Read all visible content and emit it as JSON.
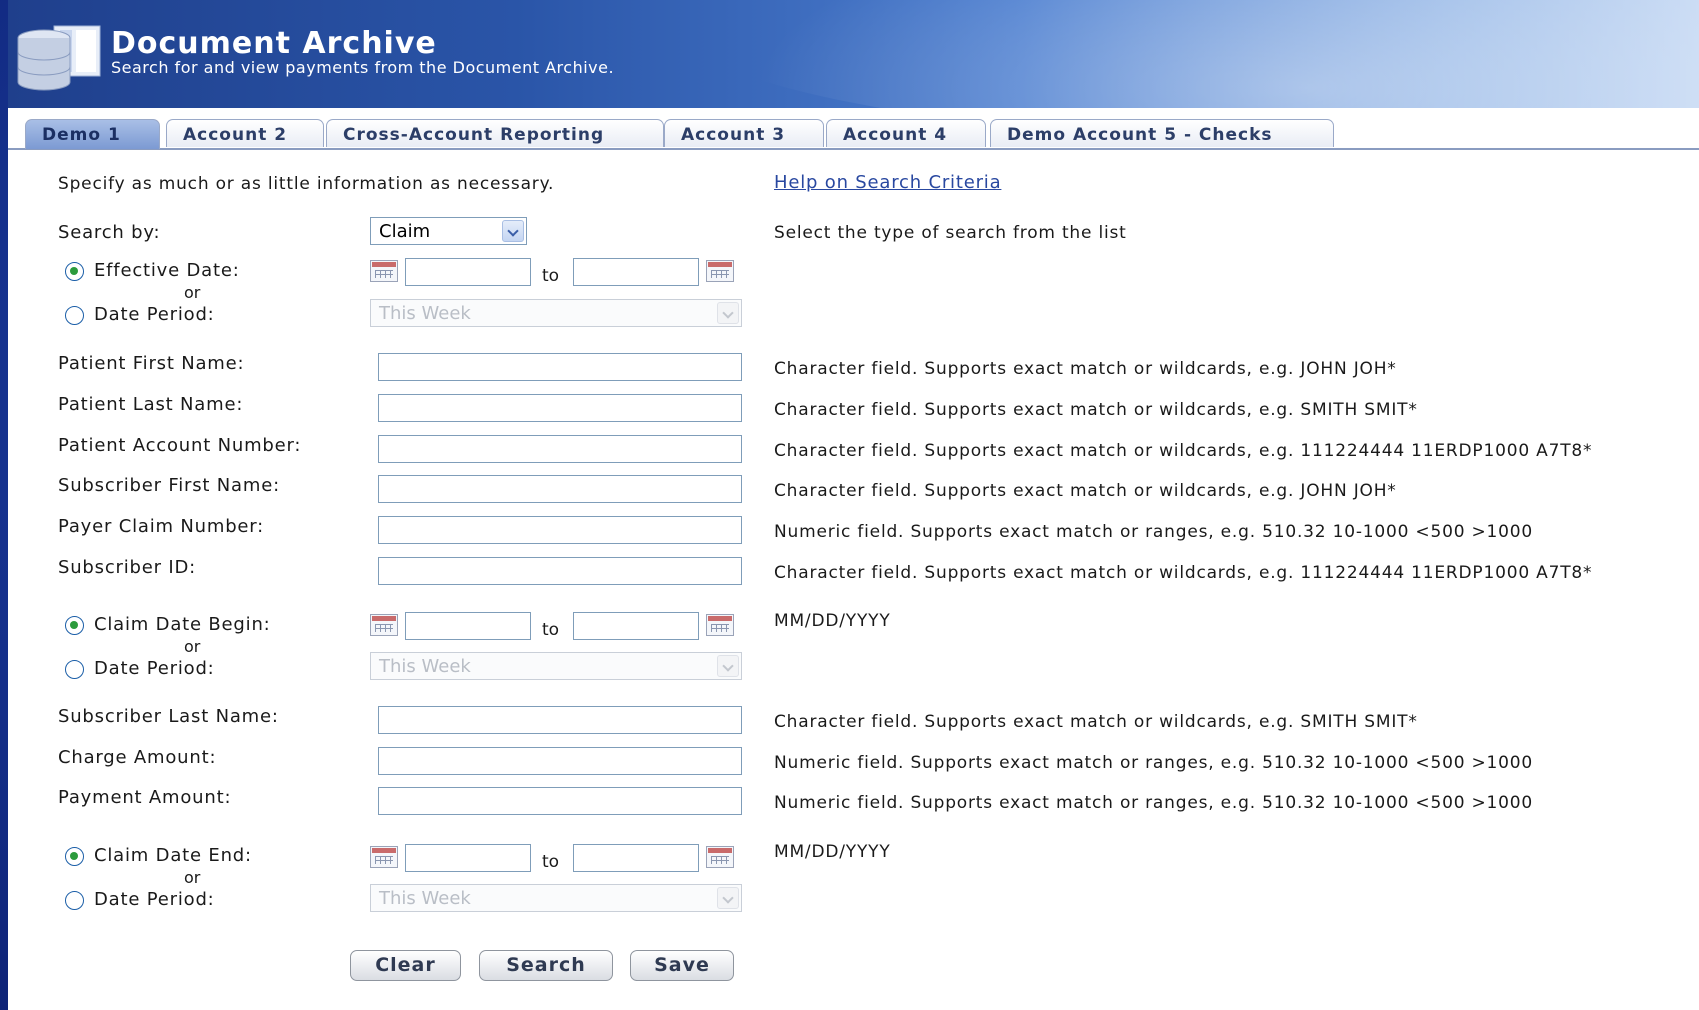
{
  "app": {
    "title": "Document Archive",
    "subtitle": "Search for and view payments from the Document Archive."
  },
  "tabs": [
    {
      "label": "Demo 1",
      "active": true
    },
    {
      "label": "Account 2",
      "active": false
    },
    {
      "label": "Cross-Account Reporting",
      "active": false
    },
    {
      "label": "Account 3",
      "active": false
    },
    {
      "label": "Account 4",
      "active": false
    },
    {
      "label": "Demo Account 5 - Checks",
      "active": false
    }
  ],
  "form": {
    "intro": "Specify as much or as little information as necessary.",
    "help_link": "Help on Search Criteria",
    "search_by": {
      "label": "Search by:",
      "value": "Claim",
      "hint": "Select the type of search from the list"
    },
    "or_text": "or",
    "to_text": "to",
    "effective_date": {
      "label": "Effective Date:",
      "checked": true
    },
    "date_period_1": {
      "label": "Date Period:",
      "value": "This Week",
      "checked": false
    },
    "patient_first_name": {
      "label": "Patient First Name:",
      "value": "",
      "hint": "Character field. Supports exact match or wildcards, e.g. JOHN JOH*"
    },
    "patient_last_name": {
      "label": "Patient Last Name:",
      "value": "",
      "hint": "Character field. Supports exact match or wildcards, e.g. SMITH SMIT*"
    },
    "patient_account_number": {
      "label": "Patient Account Number:",
      "value": "",
      "hint": "Character field. Supports exact match or wildcards, e.g. 111224444 11ERDP1000 A7T8*"
    },
    "subscriber_first_name": {
      "label": "Subscriber First Name:",
      "value": "",
      "hint": "Character field. Supports exact match or wildcards, e.g. JOHN JOH*"
    },
    "payer_claim_number": {
      "label": "Payer Claim Number:",
      "value": "",
      "hint": "Numeric field. Supports exact match or ranges, e.g. 510.32 10-1000 <500 >1000"
    },
    "subscriber_id": {
      "label": "Subscriber ID:",
      "value": "",
      "hint": "Character field. Supports exact match or wildcards, e.g. 111224444 11ERDP1000 A7T8*"
    },
    "claim_date_begin": {
      "label": "Claim Date Begin:",
      "checked": true,
      "hint": "MM/DD/YYYY"
    },
    "date_period_2": {
      "label": "Date Period:",
      "value": "This Week",
      "checked": false
    },
    "subscriber_last_name": {
      "label": "Subscriber Last Name:",
      "value": "",
      "hint": "Character field. Supports exact match or wildcards, e.g. SMITH SMIT*"
    },
    "charge_amount": {
      "label": "Charge Amount:",
      "value": "",
      "hint": "Numeric field. Supports exact match or ranges, e.g. 510.32 10-1000 <500 >1000"
    },
    "payment_amount": {
      "label": "Payment Amount:",
      "value": "",
      "hint": "Numeric field. Supports exact match or ranges, e.g. 510.32 10-1000 <500 >1000"
    },
    "claim_date_end": {
      "label": "Claim Date End:",
      "checked": true,
      "hint": "MM/DD/YYYY"
    },
    "date_period_3": {
      "label": "Date Period:",
      "value": "This Week",
      "checked": false
    }
  },
  "buttons": {
    "clear": "Clear",
    "search": "Search",
    "save": "Save"
  }
}
